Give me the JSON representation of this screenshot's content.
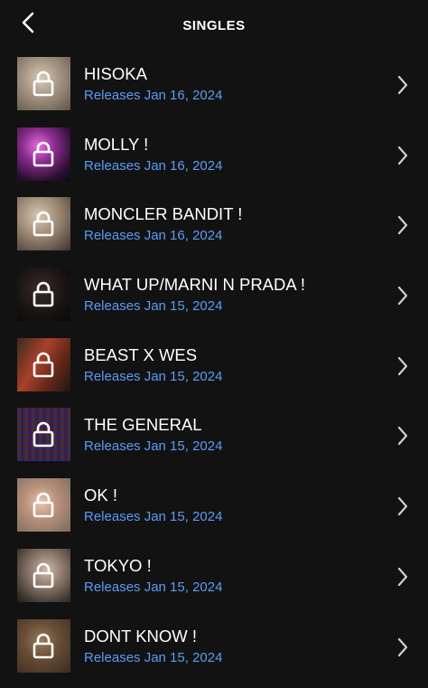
{
  "header": {
    "title": "SINGLES",
    "back_icon": "chevron-left-icon"
  },
  "colors": {
    "background": "#121212",
    "text": "#ffffff",
    "accent_date": "#5b9cf5",
    "chevron": "#d0d0d0"
  },
  "singles": [
    {
      "name": "HISOKA",
      "release": "Releases Jan 16, 2024",
      "icon": "lock-icon"
    },
    {
      "name": "MOLLY !",
      "release": "Releases Jan 16, 2024",
      "icon": "lock-icon"
    },
    {
      "name": "MONCLER BANDIT !",
      "release": "Releases Jan 16, 2024",
      "icon": "lock-icon"
    },
    {
      "name": "WHAT UP/MARNI N PRADA !",
      "release": "Releases Jan 15, 2024",
      "icon": "lock-icon"
    },
    {
      "name": "BEAST X WES",
      "release": "Releases Jan 15, 2024",
      "icon": "lock-icon"
    },
    {
      "name": "THE GENERAL",
      "release": "Releases Jan 15, 2024",
      "icon": "lock-icon"
    },
    {
      "name": "OK !",
      "release": "Releases Jan 15, 2024",
      "icon": "lock-icon"
    },
    {
      "name": "TOKYO !",
      "release": "Releases Jan 15, 2024",
      "icon": "lock-icon"
    },
    {
      "name": "DONT KNOW !",
      "release": "Releases Jan 15, 2024",
      "icon": "lock-icon"
    }
  ]
}
